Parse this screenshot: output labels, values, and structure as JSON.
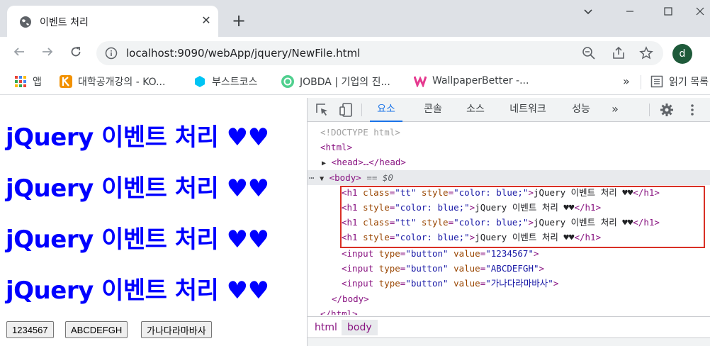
{
  "browser": {
    "tab_title": "이벤트 처리",
    "tab_close": "✕",
    "new_tab": "+",
    "url": "localhost:9090/webApp/jquery/NewFile.html",
    "avatar_letter": "d",
    "window_minimize": "⌄",
    "bookmarks": [
      {
        "label": "앱",
        "icon": "apps-grid-icon"
      },
      {
        "label": "대학공개강의 - KO...",
        "icon": "kocw-icon"
      },
      {
        "label": "부스트코스",
        "icon": "boostcourse-icon"
      },
      {
        "label": "JOBDA | 기업의 진...",
        "icon": "jobda-icon"
      },
      {
        "label": "WallpaperBetter -...",
        "icon": "wallpaperbetter-icon"
      }
    ],
    "bookmarks_overflow": "»",
    "reading_list": "읽기 목록"
  },
  "page": {
    "headings": [
      "jQuery 이벤트 처리 ♥♥",
      "jQuery 이벤트 처리 ♥♥",
      "jQuery 이벤트 처리 ♥♥",
      "jQuery 이벤트 처리 ♥♥"
    ],
    "buttons": [
      "1234567",
      "ABCDEFGH",
      "가나다라마바사"
    ],
    "heading_color": "#0000ff"
  },
  "devtools": {
    "tabs": [
      "요소",
      "콘솔",
      "소스",
      "네트워크",
      "성능"
    ],
    "more_tabs": "»",
    "active_tab": "요소",
    "source": {
      "doctype": "<!DOCTYPE html>",
      "html_open": "<html>",
      "head": "<head>…</head>",
      "body_open": "<body>",
      "body_marker": "== $0",
      "h1_lines": [
        {
          "attrs": [
            [
              "class",
              "\"tt\""
            ],
            [
              "style",
              "\"color: blue;\""
            ]
          ],
          "text": "jQuery 이벤트 처리 ♥♥"
        },
        {
          "attrs": [
            [
              "style",
              "\"color: blue;\""
            ]
          ],
          "text": "jQuery 이벤트 처리 ♥♥"
        },
        {
          "attrs": [
            [
              "class",
              "\"tt\""
            ],
            [
              "style",
              "\"color: blue;\""
            ]
          ],
          "text": "jQuery 이벤트 처리 ♥♥"
        },
        {
          "attrs": [
            [
              "style",
              "\"color: blue;\""
            ]
          ],
          "text": "jQuery 이벤트 처리 ♥♥"
        }
      ],
      "inputs": [
        {
          "type": "\"button\"",
          "value": "\"1234567\""
        },
        {
          "type": "\"button\"",
          "value": "\"ABCDEFGH\""
        },
        {
          "type": "\"button\"",
          "value": "\"가나다라마바사\""
        }
      ],
      "body_close": "</body>",
      "html_close": "</html>"
    },
    "breadcrumbs": [
      "html",
      "body"
    ],
    "active_crumb": "body",
    "highlight_color": "#d93025"
  }
}
